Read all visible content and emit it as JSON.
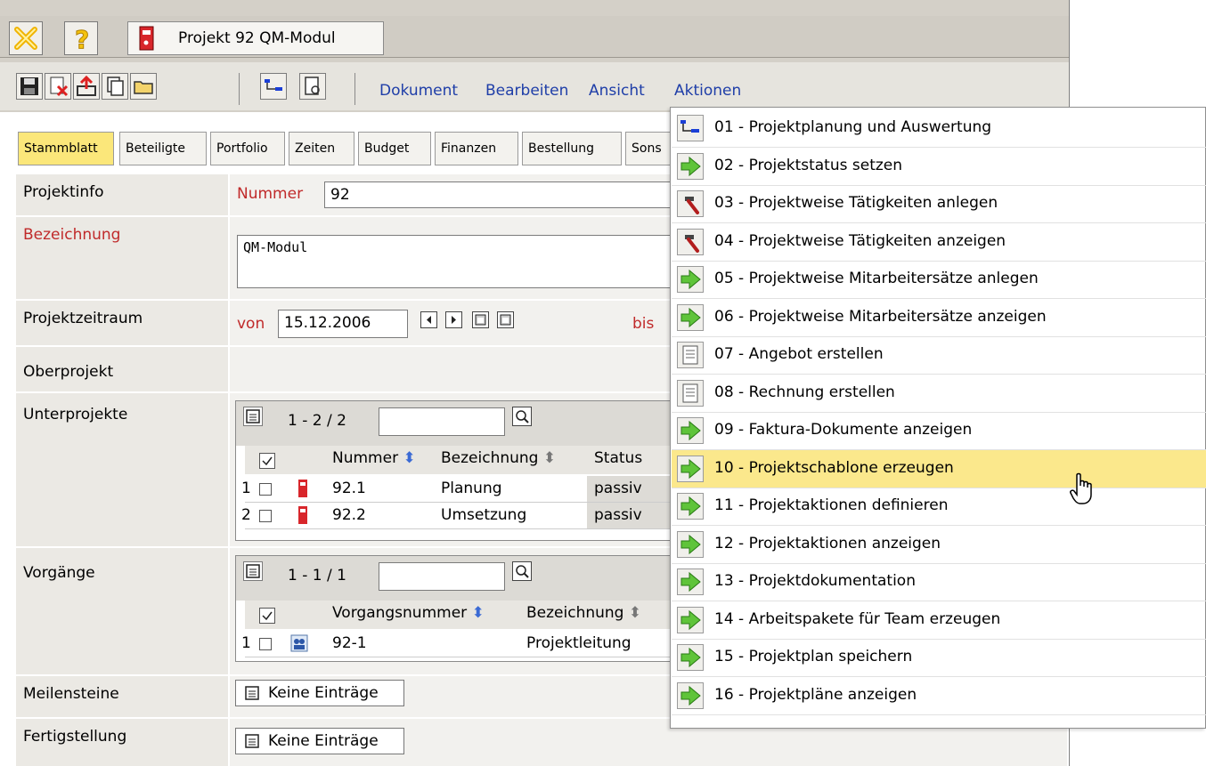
{
  "title": {
    "project_label": "Projekt 92 QM-Modul"
  },
  "menu": {
    "dokument": "Dokument",
    "bearbeiten": "Bearbeiten",
    "ansicht": "Ansicht",
    "aktionen": "Aktionen"
  },
  "tabs": [
    "Stammblatt",
    "Beteiligte",
    "Portfolio",
    "Zeiten",
    "Budget",
    "Finanzen",
    "Bestellung",
    "Sons"
  ],
  "form": {
    "projektinfo": "Projektinfo",
    "nummer_label": "Nummer",
    "nummer_value": "92",
    "bezeichnung_label": "Bezeichnung",
    "bezeichnung_value": "QM-Modul",
    "projektzeitraum": "Projektzeitraum",
    "von_label": "von",
    "von_value": "15.12.2006",
    "bis_label": "bis",
    "oberprojekt": "Oberprojekt",
    "unterprojekte": "Unterprojekte",
    "vorgaenge": "Vorgänge",
    "meilensteine": "Meilensteine",
    "fertigstellung": "Fertigstellung",
    "keine_eintraege": "Keine Einträge"
  },
  "unterprojekte_grid": {
    "count": "1 - 2 / 2",
    "columns": {
      "nummer": "Nummer",
      "bezeichnung": "Bezeichnung",
      "status": "Status"
    },
    "rows": [
      {
        "index": "1",
        "nummer": "92.1",
        "bezeichnung": "Planung",
        "status": "passiv"
      },
      {
        "index": "2",
        "nummer": "92.2",
        "bezeichnung": "Umsetzung",
        "status": "passiv"
      }
    ]
  },
  "vorgaenge_grid": {
    "count": "1 - 1 / 1",
    "columns": {
      "vorgangsnummer": "Vorgangsnummer",
      "bezeichnung": "Bezeichnung"
    },
    "rows": [
      {
        "index": "1",
        "nummer": "92-1",
        "bezeichnung": "Projektleitung"
      }
    ]
  },
  "actions_menu": [
    {
      "label": "01 - Projektplanung und Auswertung",
      "icon": "gantt-icon"
    },
    {
      "label": "02 - Projektstatus setzen",
      "icon": "arrow-right-icon"
    },
    {
      "label": "03 - Projektweise Tätigkeiten anlegen",
      "icon": "hammer-icon"
    },
    {
      "label": "04 - Projektweise Tätigkeiten anzeigen",
      "icon": "hammer-icon"
    },
    {
      "label": "05 - Projektweise Mitarbeitersätze anlegen",
      "icon": "arrow-right-icon"
    },
    {
      "label": "06 - Projektweise Mitarbeitersätze anzeigen",
      "icon": "arrow-right-icon"
    },
    {
      "label": "07 - Angebot erstellen",
      "icon": "document-icon"
    },
    {
      "label": "08 - Rechnung erstellen",
      "icon": "document-icon"
    },
    {
      "label": "09 - Faktura-Dokumente anzeigen",
      "icon": "arrow-right-icon"
    },
    {
      "label": "10 - Projektschablone erzeugen",
      "icon": "arrow-right-icon"
    },
    {
      "label": "11 - Projektaktionen definieren",
      "icon": "arrow-right-icon"
    },
    {
      "label": "12 - Projektaktionen anzeigen",
      "icon": "arrow-right-icon"
    },
    {
      "label": "13 - Projektdokumentation",
      "icon": "arrow-right-icon"
    },
    {
      "label": "14 - Arbeitspakete für Team erzeugen",
      "icon": "arrow-right-icon"
    },
    {
      "label": "15 - Projektplan speichern",
      "icon": "arrow-right-icon"
    },
    {
      "label": "16 - Projektpläne anzeigen",
      "icon": "arrow-right-icon"
    }
  ],
  "highlighted_action_index": 9,
  "colors": {
    "link": "#1f3ea8",
    "required_label": "#c02a2a",
    "active_tab": "#fbe77a",
    "highlight": "#fbe88c"
  }
}
